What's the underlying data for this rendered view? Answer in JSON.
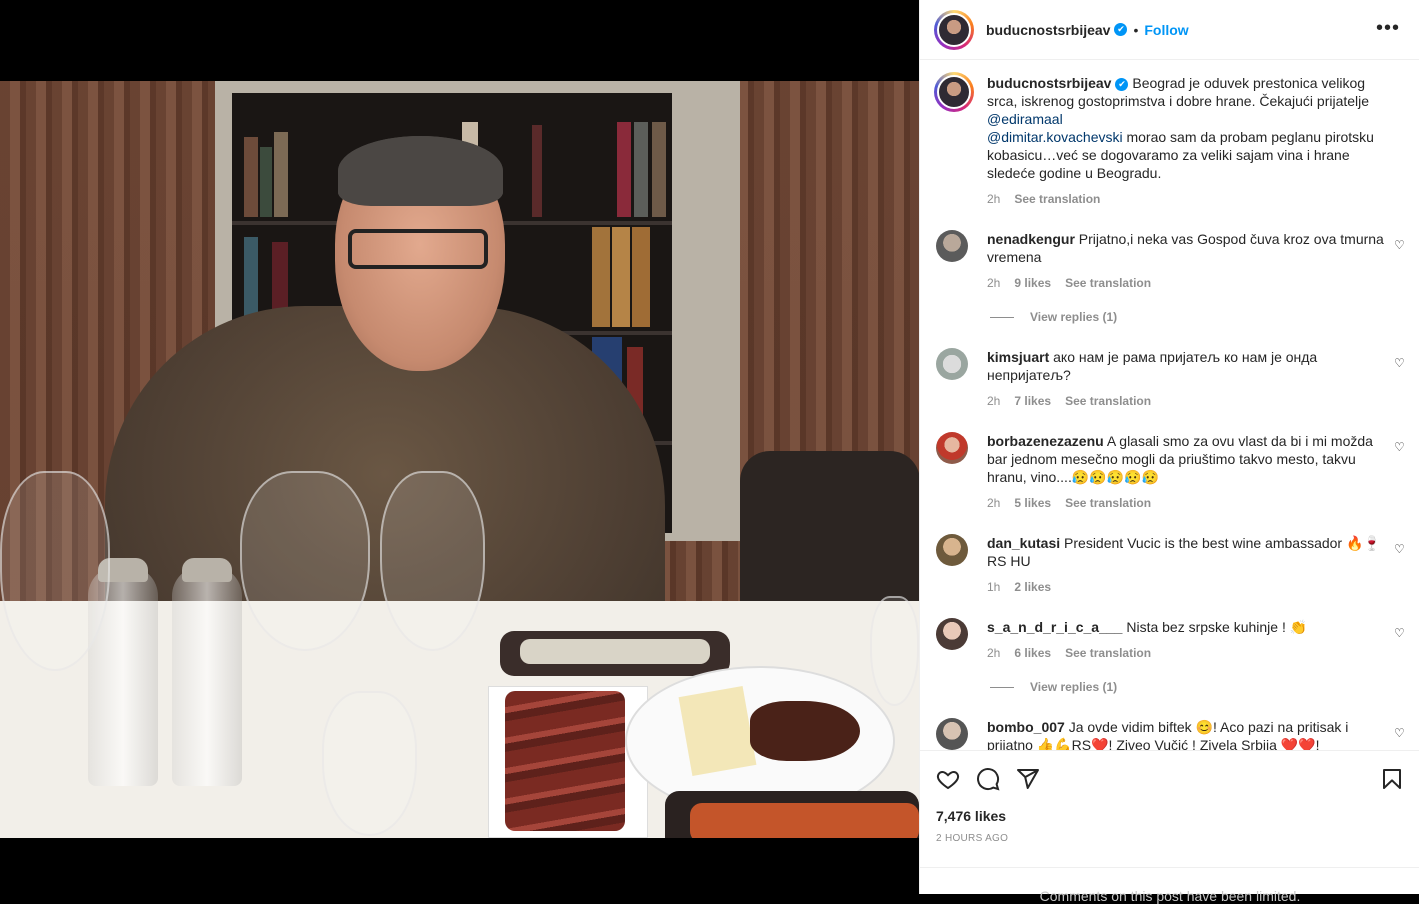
{
  "post": {
    "username": "buducnostsrbijeav",
    "verified_mark": "✔",
    "separator": "•",
    "follow_label": "Follow",
    "more_label": "•••"
  },
  "caption": {
    "username": "buducnostsrbijeav",
    "text_1": "Beograd je oduvek prestonica velikog srca, iskrenog gostoprimstva i dobre hrane. Čekajući prijatelje",
    "mention_1": "@ediramaal",
    "mention_2": "@dimitar.kovachevski",
    "text_2": "morao sam da probam peglanu pirotsku kobasicu…već se dogovaramo za veliki sajam vina i hrane sledeće godine u Beogradu.",
    "time": "2h",
    "see_translation": "See translation"
  },
  "comments": [
    {
      "username": "nenadkengur",
      "text": "Prijatno,i neka vas Gospod čuva kroz ova tmurna vremena",
      "time": "2h",
      "likes": "9 likes",
      "see_translation": "See translation",
      "view_replies": "View replies (1)"
    },
    {
      "username": "kimsjuart",
      "text": "ако нам је рама пријатељ ко нам је онда непријатељ?",
      "time": "2h",
      "likes": "7 likes",
      "see_translation": "See translation"
    },
    {
      "username": "borbazenezazenu",
      "text": "A glasali smo za ovu vlast da bi i mi možda bar jednom mesečno mogli da priuštimo takvo mesto, takvu hranu, vino....😥😥😥😥😥",
      "time": "2h",
      "likes": "5 likes",
      "see_translation": "See translation"
    },
    {
      "username": "dan_kutasi",
      "text": "President Vucic is the best wine ambassador 🔥🍷RS HU",
      "time": "1h",
      "likes": "2 likes"
    },
    {
      "username": "s_a_n_d_r_i_c_a___",
      "text": "Nista bez srpske kuhinje ! 👏",
      "time": "2h",
      "likes": "6 likes",
      "see_translation": "See translation",
      "view_replies": "View replies (1)"
    },
    {
      "username": "bombo_007",
      "text": "Ja ovde vidim biftek 😊! Aco pazi na pritisak i prijatno 👍💪RS❤️! Ziveo Vučić ! Zivela Srbija ❤️❤️!",
      "time": "",
      "likes": ""
    }
  ],
  "footer": {
    "likes": "7,476 likes",
    "time": "2 HOURS AGO",
    "limited": "Comments on this post have been limited."
  },
  "icons": {
    "like": "heart-icon",
    "comment": "comment-icon",
    "share": "share-icon",
    "save": "bookmark-icon",
    "comment_like": "heart-small-icon"
  }
}
